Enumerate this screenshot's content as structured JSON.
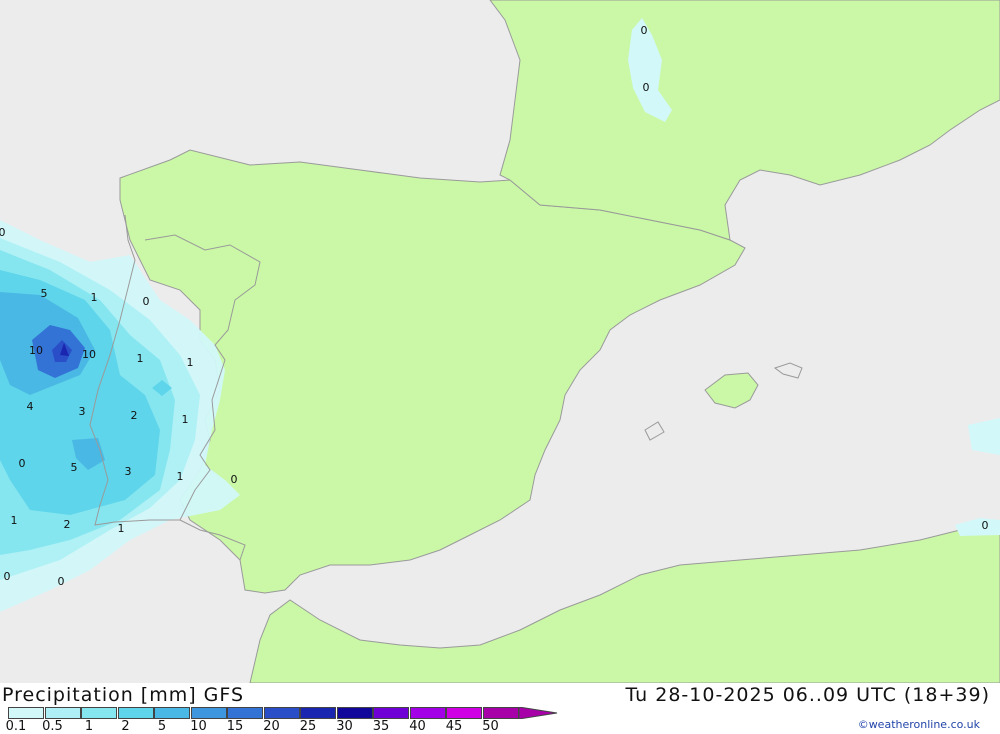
{
  "footer": {
    "title": "Precipitation [mm] GFS",
    "datetime": "Tu 28-10-2025 06..09 UTC (18+39)",
    "credit": "©weatheronline.co.uk"
  },
  "legend": {
    "ticks": [
      "0.1",
      "0.5",
      "1",
      "2",
      "5",
      "10",
      "15",
      "20",
      "25",
      "30",
      "35",
      "40",
      "45",
      "50"
    ],
    "colors": [
      "#d2f8fa",
      "#aef0f5",
      "#86e6f0",
      "#5ed5ea",
      "#4ab8e4",
      "#3e96de",
      "#3473d6",
      "#2a4ec8",
      "#1a25b0",
      "#11079a",
      "#6f00d6",
      "#a400e8",
      "#cf00e4",
      "#a800a8"
    ]
  },
  "map": {
    "colors": {
      "sea": "#ececec",
      "land": "#caf8a6",
      "border": "#9a9a9a"
    },
    "contour_labels": [
      "0",
      "5",
      "1",
      "0",
      "10",
      "10",
      "1",
      "1",
      "4",
      "3",
      "2",
      "1",
      "0",
      "5",
      "3",
      "1",
      "0",
      "1",
      "2",
      "1",
      "0",
      "0",
      "0",
      "0",
      "0"
    ]
  }
}
